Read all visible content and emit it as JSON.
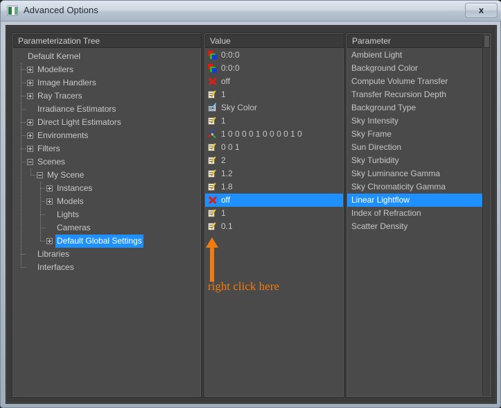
{
  "window": {
    "title": "Advanced Options",
    "title_icon": "app-window-icon",
    "close_label": "x"
  },
  "tree_panel": {
    "header": "Parameterization Tree",
    "items": [
      {
        "label": "Default Kernel",
        "depth": 0,
        "expander": "none"
      },
      {
        "label": "Modellers",
        "depth": 1,
        "expander": "plus"
      },
      {
        "label": "Image Handlers",
        "depth": 1,
        "expander": "plus"
      },
      {
        "label": "Ray Tracers",
        "depth": 1,
        "expander": "plus"
      },
      {
        "label": "Irradiance Estimators",
        "depth": 1,
        "expander": "none"
      },
      {
        "label": "Direct Light Estimators",
        "depth": 1,
        "expander": "plus"
      },
      {
        "label": "Environments",
        "depth": 1,
        "expander": "plus"
      },
      {
        "label": "Filters",
        "depth": 1,
        "expander": "plus"
      },
      {
        "label": "Scenes",
        "depth": 1,
        "expander": "minus"
      },
      {
        "label": "My Scene",
        "depth": 2,
        "expander": "minus"
      },
      {
        "label": "Instances",
        "depth": 3,
        "expander": "plus"
      },
      {
        "label": "Models",
        "depth": 3,
        "expander": "plus"
      },
      {
        "label": "Lights",
        "depth": 3,
        "expander": "none"
      },
      {
        "label": "Cameras",
        "depth": 3,
        "expander": "none"
      },
      {
        "label": "Default Global Settings",
        "depth": 3,
        "expander": "plus",
        "selected": true
      },
      {
        "label": "Libraries",
        "depth": 1,
        "expander": "none"
      },
      {
        "label": "Interfaces",
        "depth": 1,
        "expander": "none"
      }
    ]
  },
  "value_panel": {
    "header": "Value"
  },
  "param_panel": {
    "header": "Parameter"
  },
  "rows": [
    {
      "value": "0:0:0",
      "icon": "rgb-color-icon",
      "parameter": "Ambient Light"
    },
    {
      "value": "0:0:0",
      "icon": "rgb-color-icon",
      "parameter": "Background Color"
    },
    {
      "value": "off",
      "icon": "red-x-icon",
      "parameter": "Compute Volume Transfer"
    },
    {
      "value": "1",
      "icon": "note-pencil-icon",
      "parameter": "Transfer Recursion Depth"
    },
    {
      "value": "Sky Color",
      "icon": "document-pencil-icon",
      "parameter": "Background Type"
    },
    {
      "value": "1",
      "icon": "note-pencil-icon",
      "parameter": "Sky Intensity"
    },
    {
      "value": "1 0 0 0 0 1 0 0 0 0 1 0",
      "icon": "axis-gizmo-icon",
      "parameter": "Sky Frame"
    },
    {
      "value": "0 0 1",
      "icon": "note-pencil-icon",
      "parameter": "Sun Direction"
    },
    {
      "value": "2",
      "icon": "note-pencil-icon",
      "parameter": "Sky Turbidity"
    },
    {
      "value": "1.2",
      "icon": "note-pencil-icon",
      "parameter": "Sky Luminance Gamma"
    },
    {
      "value": "1.8",
      "icon": "note-pencil-icon",
      "parameter": "Sky Chromaticity Gamma"
    },
    {
      "value": "off",
      "icon": "red-x-icon",
      "parameter": "Linear Lightflow",
      "selected": true
    },
    {
      "value": "1",
      "icon": "note-pencil-icon",
      "parameter": "Index of Refraction"
    },
    {
      "value": "0.1",
      "icon": "note-pencil-icon",
      "parameter": "Scatter Density"
    }
  ],
  "annotation": {
    "text": "right click here",
    "color": "#f07b10"
  },
  "colors": {
    "selection": "#1e90ff",
    "panel_bg": "#4a4a4a",
    "header_bg": "#3a3a3a",
    "text": "#c6c6c6",
    "titlebar": "#cfd8e2"
  }
}
